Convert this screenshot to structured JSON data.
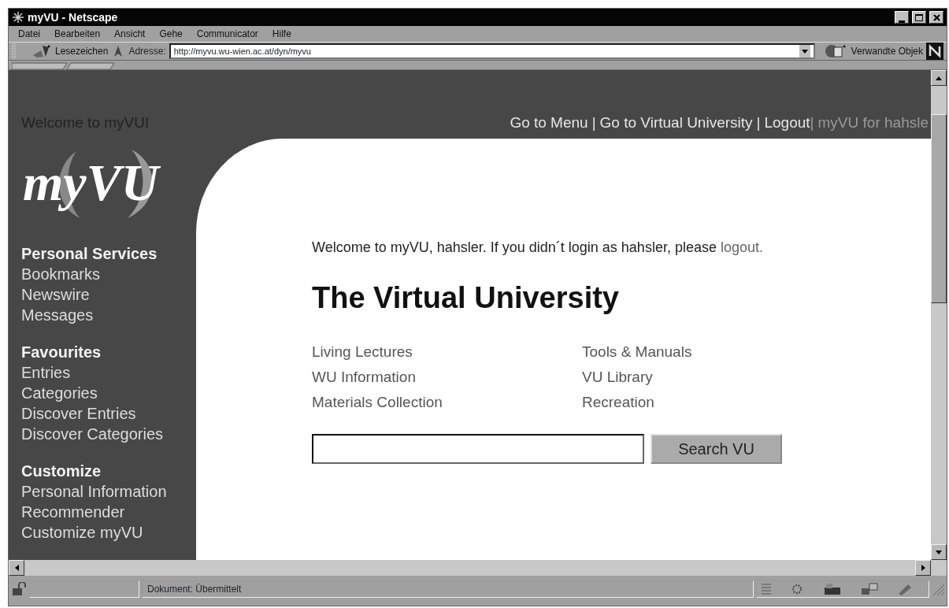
{
  "window": {
    "title": "myVU - Netscape"
  },
  "menu": [
    "Datei",
    "Bearbeiten",
    "Ansicht",
    "Gehe",
    "Communicator",
    "Hilfe"
  ],
  "toolbar": {
    "bookmarks": "Lesezeichen",
    "address_label": "Adresse:",
    "url": "http://myvu.wu-wien.ac.at/dyn/myvu",
    "related": "Verwandte Objek"
  },
  "page": {
    "welcome_title": "Welcome to myVUI",
    "header_nav": [
      {
        "kind": "link",
        "text": "Go to Menu"
      },
      {
        "kind": "separator",
        "text": "|"
      },
      {
        "kind": "link",
        "text": "Go to Virtual University"
      },
      {
        "kind": "separator",
        "text": "|"
      },
      {
        "kind": "link",
        "text": "Logout"
      },
      {
        "kind": "dim",
        "text": "|"
      },
      {
        "kind": "dim",
        "text": "myVU for hahsle"
      }
    ],
    "logo": "myVU",
    "sidebar": [
      {
        "title": "Personal Services",
        "items": [
          "Bookmarks",
          "Newswire",
          "Messages"
        ]
      },
      {
        "title": "Favourites",
        "items": [
          "Entries",
          "Categories",
          "Discover Entries",
          "Discover Categories"
        ]
      },
      {
        "title": "Customize",
        "items": [
          "Personal Information",
          "Recommender",
          "Customize myVU"
        ]
      }
    ],
    "welcome": {
      "text": "Welcome to myVU, hahsler. If you didn´t login as hahsler, please",
      "link": "logout."
    },
    "heading": "The Virtual University",
    "links": [
      [
        "Living Lectures",
        "WU Information",
        "Materials Collection"
      ],
      [
        "Tools & Manuals",
        "VU Library",
        "Recreation"
      ]
    ],
    "search_button": "Search VU"
  },
  "status_bar": {
    "text": "Dokument: Übermittelt"
  }
}
